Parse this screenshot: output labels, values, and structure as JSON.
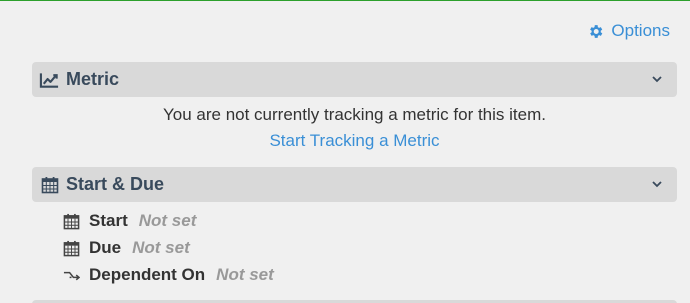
{
  "options": {
    "label": "Options",
    "icon": "gear-icon",
    "color": "#3a8fd6"
  },
  "metric": {
    "title": "Metric",
    "icon": "line-chart-icon",
    "message": "You are not currently tracking a metric for this item.",
    "link_label": "Start Tracking a Metric"
  },
  "dates": {
    "title": "Start & Due",
    "icon": "calendar-icon",
    "rows": [
      {
        "label": "Start",
        "value": "Not set",
        "icon": "calendar-icon"
      },
      {
        "label": "Due",
        "value": "Not set",
        "icon": "calendar-icon"
      },
      {
        "label": "Dependent On",
        "value": "Not set",
        "icon": "dependency-icon"
      }
    ]
  }
}
